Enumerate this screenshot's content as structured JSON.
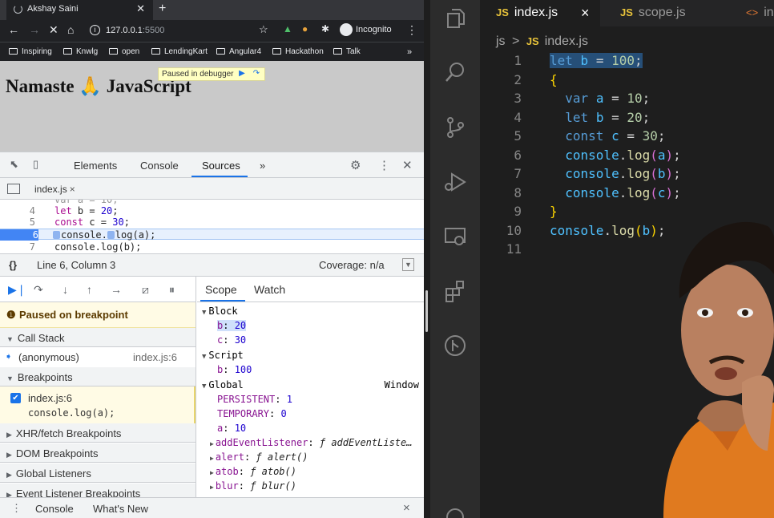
{
  "browser": {
    "tab_title": "Akshay Saini",
    "omnibox": {
      "host": "127.0.0.1",
      "port": ":5500"
    },
    "incognito_label": "Incognito",
    "bookmarks": [
      "Inspiring",
      "Knwlg",
      "open",
      "LendingKart",
      "Angular4",
      "Hackathon",
      "Talk"
    ],
    "bookmarks_more": "»"
  },
  "page": {
    "heading": "Namaste 🙏 JavaScript",
    "debugger_pill": "Paused in debugger"
  },
  "devtools": {
    "tabs": [
      "Elements",
      "Console",
      "Sources"
    ],
    "active_tab": "Sources",
    "more_tabs": "»",
    "file_tab": "index.js",
    "file_tab_close": "×",
    "code_lines": [
      {
        "n": "4",
        "code": "let b = 20;"
      },
      {
        "n": "5",
        "code": "const c = 30;"
      },
      {
        "n": "6",
        "code": "console.log(a);"
      },
      {
        "n": "7",
        "code": "console.log(b);"
      }
    ],
    "status": {
      "braces": "{}",
      "position": "Line 6, Column 3",
      "coverage": "Coverage: n/a"
    },
    "paused_text": "Paused on breakpoint",
    "sections": {
      "call_stack": "Call Stack",
      "breakpoints": "Breakpoints",
      "xhr": "XHR/fetch Breakpoints",
      "dom": "DOM Breakpoints",
      "global_listeners": "Global Listeners",
      "event_listener": "Event Listener Breakpoints"
    },
    "call_stack_frame": {
      "name": "(anonymous)",
      "location": "index.js:6"
    },
    "breakpoint": {
      "file": "index.js:6",
      "code": "console.log(a);",
      "checked": true
    },
    "scope_tabs": [
      "Scope",
      "Watch"
    ],
    "scope": {
      "block_label": "Block",
      "block": [
        {
          "name": "b",
          "value": "20"
        },
        {
          "name": "c",
          "value": "30"
        }
      ],
      "script_label": "Script",
      "script": [
        {
          "name": "b",
          "value": "100"
        }
      ],
      "global_label": "Global",
      "global_value": "Window",
      "global": [
        {
          "name": "PERSISTENT",
          "value": "1"
        },
        {
          "name": "TEMPORARY",
          "value": "0"
        },
        {
          "name": "a",
          "value": "10"
        }
      ],
      "global_fns": [
        {
          "name": "addEventListener",
          "value": "ƒ addEventListe…"
        },
        {
          "name": "alert",
          "value": "ƒ alert()"
        },
        {
          "name": "atob",
          "value": "ƒ atob()"
        },
        {
          "name": "blur",
          "value": "ƒ blur()"
        }
      ]
    },
    "drawer_tabs": [
      "Console",
      "What's New"
    ],
    "drawer_close": "×"
  },
  "vscode": {
    "tabs": [
      {
        "badge": "JS",
        "label": "index.js",
        "close": "×"
      },
      {
        "badge": "JS",
        "label": "scope.js"
      },
      {
        "badge": "<>",
        "label": "in"
      }
    ],
    "breadcrumb": {
      "folder": "js",
      "sep": ">",
      "badge": "JS",
      "file": "index.js"
    }
  }
}
